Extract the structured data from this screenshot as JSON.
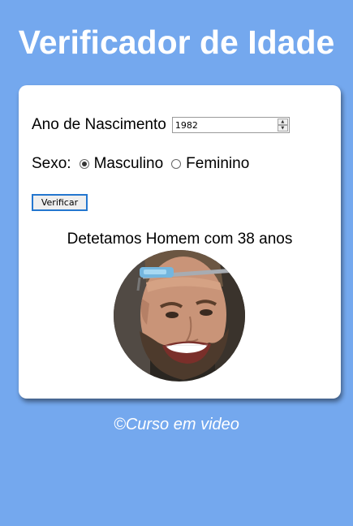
{
  "page": {
    "title": "Verificador de Idade",
    "background_color": "#74a8ee"
  },
  "form": {
    "year_label": "Ano de Nascimento",
    "year_value": "1982",
    "sex_label": "Sexo:",
    "options": [
      {
        "label": "Masculino",
        "checked": true
      },
      {
        "label": "Feminino",
        "checked": false
      }
    ],
    "verify_button": "Verificar"
  },
  "result": {
    "text": "Detetamos Homem com 38 anos",
    "photo": "man-with-glasses-portrait"
  },
  "footer": {
    "text": "©Curso em video"
  }
}
